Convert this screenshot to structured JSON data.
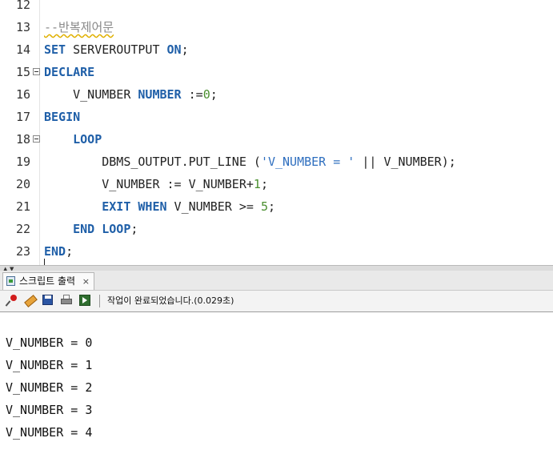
{
  "editor": {
    "lines": [
      {
        "num": "12",
        "fold": false,
        "tokens": []
      },
      {
        "num": "13",
        "fold": false,
        "tokens": [
          {
            "t": "--반복제어문",
            "c": "cmt squiggle"
          }
        ]
      },
      {
        "num": "14",
        "fold": false,
        "tokens": [
          {
            "t": "SET",
            "c": "kw"
          },
          {
            "t": " SERVEROUTPUT ",
            "c": ""
          },
          {
            "t": "ON",
            "c": "kw"
          },
          {
            "t": ";",
            "c": ""
          }
        ]
      },
      {
        "num": "15",
        "fold": true,
        "tokens": [
          {
            "t": "DECLARE",
            "c": "kw"
          }
        ]
      },
      {
        "num": "16",
        "fold": false,
        "tokens": [
          {
            "t": "    V_NUMBER ",
            "c": ""
          },
          {
            "t": "NUMBER",
            "c": "kw"
          },
          {
            "t": " :=",
            "c": ""
          },
          {
            "t": "0",
            "c": "num"
          },
          {
            "t": ";",
            "c": ""
          }
        ]
      },
      {
        "num": "17",
        "fold": false,
        "tokens": [
          {
            "t": "BEGIN",
            "c": "kw"
          }
        ]
      },
      {
        "num": "18",
        "fold": true,
        "tokens": [
          {
            "t": "    ",
            "c": ""
          },
          {
            "t": "LOOP",
            "c": "kw"
          }
        ]
      },
      {
        "num": "19",
        "fold": false,
        "tokens": [
          {
            "t": "        DBMS_OUTPUT.PUT_LINE (",
            "c": ""
          },
          {
            "t": "'V_NUMBER = '",
            "c": "str"
          },
          {
            "t": " || V_NUMBER);",
            "c": ""
          }
        ]
      },
      {
        "num": "20",
        "fold": false,
        "tokens": [
          {
            "t": "        V_NUMBER := V_NUMBER+",
            "c": ""
          },
          {
            "t": "1",
            "c": "num"
          },
          {
            "t": ";",
            "c": ""
          }
        ]
      },
      {
        "num": "21",
        "fold": false,
        "tokens": [
          {
            "t": "        ",
            "c": ""
          },
          {
            "t": "EXIT WHEN",
            "c": "kw"
          },
          {
            "t": " V_NUMBER >= ",
            "c": ""
          },
          {
            "t": "5",
            "c": "num"
          },
          {
            "t": ";",
            "c": ""
          }
        ]
      },
      {
        "num": "22",
        "fold": false,
        "tokens": [
          {
            "t": "    ",
            "c": ""
          },
          {
            "t": "END LOOP",
            "c": "kw"
          },
          {
            "t": ";",
            "c": ""
          }
        ]
      },
      {
        "num": "23",
        "fold": false,
        "tokens": [
          {
            "t": "END",
            "c": "kw"
          },
          {
            "t": ";",
            "c": ""
          }
        ]
      }
    ]
  },
  "panel": {
    "tab_label": "스크립트 출력",
    "tab_close": "×",
    "status": "작업이 완료되었습니다.(0.029초)"
  },
  "output": {
    "lines": [
      "V_NUMBER = 0",
      "V_NUMBER = 1",
      "V_NUMBER = 2",
      "V_NUMBER = 3",
      "V_NUMBER = 4"
    ]
  },
  "icons": [
    "pin-icon",
    "eraser-icon",
    "save-icon",
    "print-icon",
    "run-icon"
  ],
  "colors": {
    "keyword": "#1f5fa8",
    "number": "#4a8f2f",
    "string": "#2f6fbf",
    "comment": "#8a8a8a"
  }
}
